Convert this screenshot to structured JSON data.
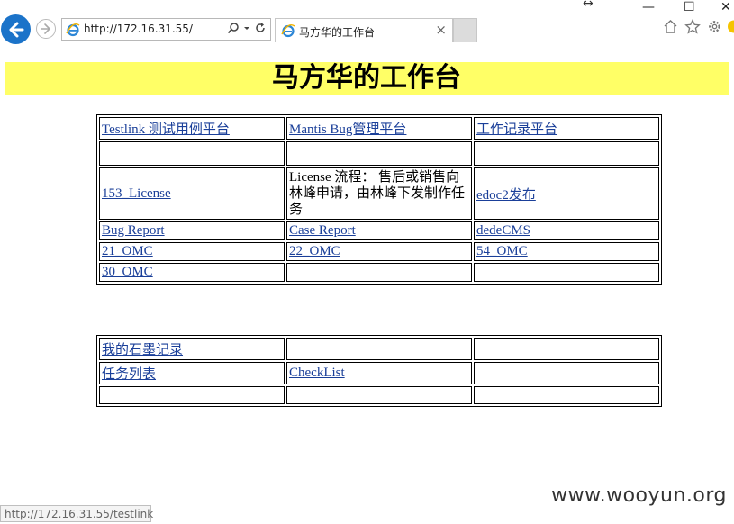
{
  "browser": {
    "address": "http://172.16.31.55/",
    "tab_title": "马方华的工作台",
    "tab_close": "×",
    "resize_glyph": "↔",
    "window_controls": {
      "minimize": "—",
      "maximize": "☐",
      "close": "✕"
    },
    "accent_color": "#1b73c9"
  },
  "page": {
    "title": "马方华的工作台",
    "title_bg": "#ffff66"
  },
  "table1": {
    "rows": [
      [
        "Testlink 测试用例平台",
        "Mantis Bug管理平台",
        "工作记录平台"
      ],
      [
        "",
        "",
        ""
      ],
      [
        "153_License",
        "License 流程： 售后或销售向林峰申请，由林峰下发制作任务",
        "edoc2发布"
      ],
      [
        "Bug Report",
        "Case Report",
        "dedeCMS"
      ],
      [
        "21_OMC",
        "22_OMC",
        "54_OMC"
      ],
      [
        "30_OMC",
        "",
        ""
      ]
    ]
  },
  "table2": {
    "rows": [
      [
        "我的石墨记录",
        "",
        ""
      ],
      [
        "任务列表",
        "CheckList",
        ""
      ],
      [
        "",
        "",
        ""
      ]
    ]
  },
  "status_bar": {
    "text": "http://172.16.31.55/testlink"
  },
  "watermark": {
    "text": "www.wooyun.org"
  }
}
